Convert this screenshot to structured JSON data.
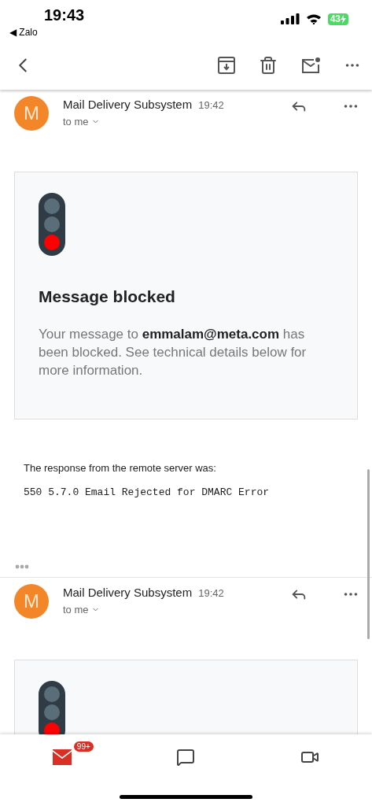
{
  "status_bar": {
    "time": "19:43",
    "back_app": "◀ Zalo",
    "battery": "43"
  },
  "messages": [
    {
      "avatar": "M",
      "sender": "Mail Delivery Subsystem",
      "time": "19:42",
      "recipient": "to me",
      "card": {
        "blocked": true,
        "title": "Message blocked",
        "body": "Your message to **emmalam@meta.com** has been blocked. See technical details below for more information."
      },
      "response_label": "The response from the remote server was:",
      "response_code": "550 5.7.0 Email Rejected for DMARC Error"
    },
    {
      "avatar": "M",
      "sender": "Mail Delivery Subsystem",
      "time": "19:42",
      "recipient": "to me",
      "card": {
        "blocked": true
      }
    }
  ],
  "bottom_nav": [
    {
      "kind": "mail",
      "badge": "99+",
      "selected": true
    },
    {
      "kind": "chat",
      "selected": false
    },
    {
      "kind": "video",
      "selected": false
    }
  ]
}
